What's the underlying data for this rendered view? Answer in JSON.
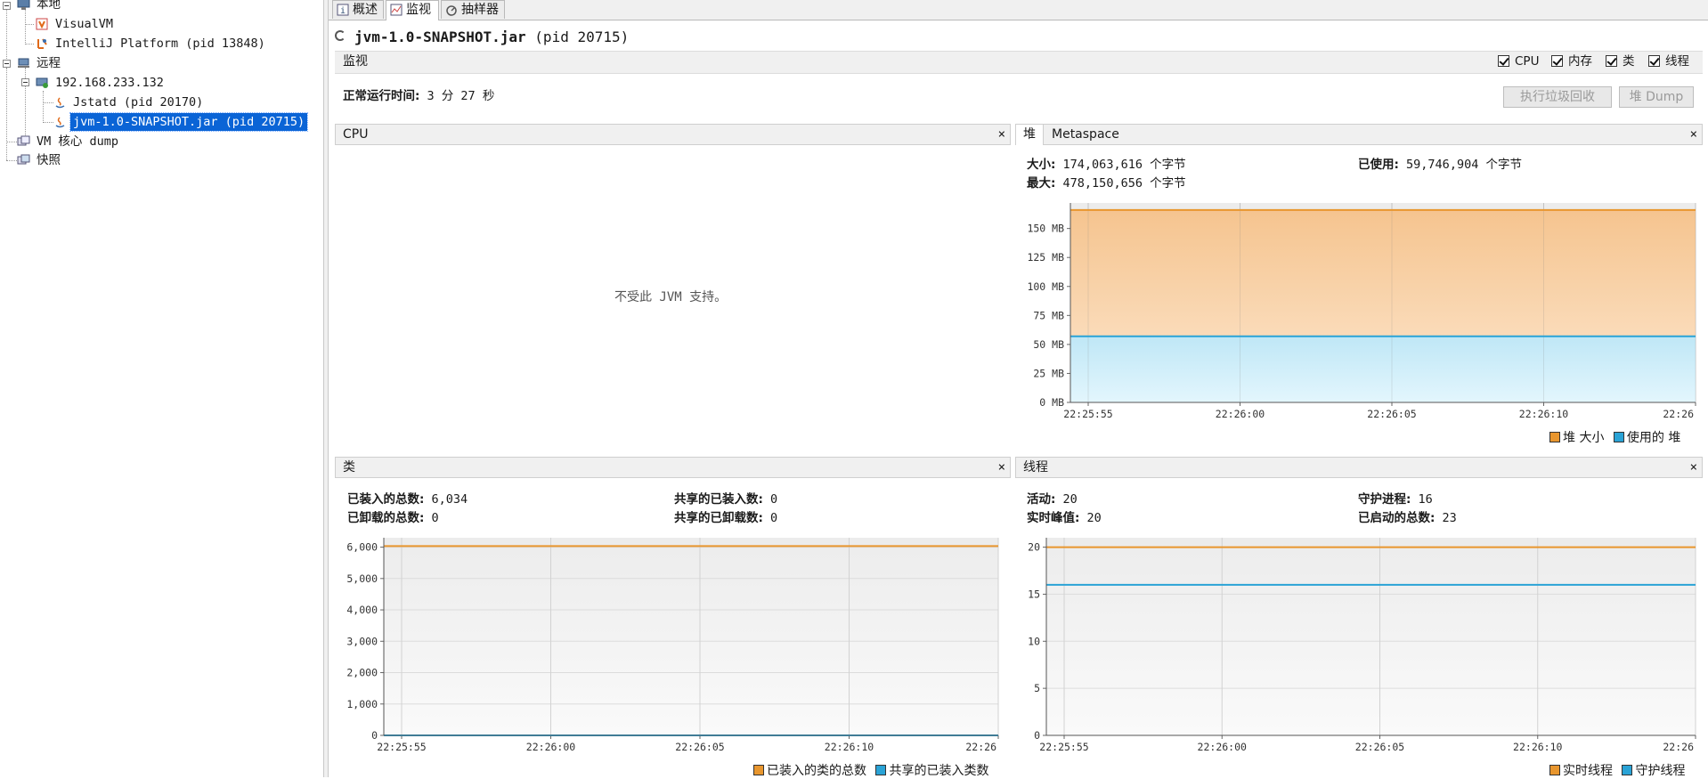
{
  "tree": {
    "local": "本地",
    "visualvm": "VisualVM",
    "intellij": "IntelliJ Platform (pid 13848)",
    "remote": "远程",
    "host": "192.168.233.132",
    "jstatd": "Jstatd (pid 20170)",
    "jvm": "jvm-1.0-SNAPSHOT.jar (pid 20715)",
    "coredump": "VM 核心 dump",
    "snapshots": "快照"
  },
  "tabs": [
    {
      "label": "概述"
    },
    {
      "label": "监视"
    },
    {
      "label": "抽样器"
    }
  ],
  "app": {
    "name": "jvm-1.0-SNAPSHOT.jar",
    "pid": "(pid 20715)"
  },
  "monitor": {
    "label": "监视",
    "checks": [
      "CPU",
      "内存",
      "类",
      "线程"
    ],
    "uptime_label": "正常运行时间:",
    "uptime_value": "3 分 27 秒",
    "gc_button": "执行垃圾回收",
    "dump_button": "堆 Dump"
  },
  "cpu_panel": {
    "title": "CPU",
    "close": "×",
    "message": "不受此 JVM 支持。"
  },
  "heap_panel": {
    "tab_heap": "堆",
    "tab_meta": "Metaspace",
    "close": "×",
    "size_label": "大小:",
    "size_value": "174,063,616 个字节",
    "max_label": "最大:",
    "max_value": "478,150,656 个字节",
    "used_label": "已使用:",
    "used_value": "59,746,904 个字节",
    "legend": [
      "堆 大小",
      "使用的 堆"
    ]
  },
  "classes_panel": {
    "title": "类",
    "close": "×",
    "loaded_label": "已装入的总数:",
    "loaded_value": "6,034",
    "unloaded_label": "已卸载的总数:",
    "unloaded_value": "0",
    "shared_loaded_label": "共享的已装入数:",
    "shared_loaded_value": "0",
    "shared_unloaded_label": "共享的已卸载数:",
    "shared_unloaded_value": "0",
    "legend": [
      "已装入的类的总数",
      "共享的已装入类数"
    ]
  },
  "threads_panel": {
    "title": "线程",
    "close": "×",
    "live_label": "活动:",
    "live_value": "20",
    "peak_label": "实时峰值:",
    "peak_value": "20",
    "daemon_label": "守护进程:",
    "daemon_value": "16",
    "started_label": "已启动的总数:",
    "started_value": "23",
    "legend": [
      "实时线程",
      "守护线程"
    ]
  },
  "colors": {
    "orange": "#e8962e",
    "blue": "#2aa3d6",
    "orange_fill_top": "#f5c48f",
    "orange_fill_bottom": "#fde7cf",
    "blue_fill_top": "#bfe7f6",
    "blue_fill_bottom": "#e3f6fd",
    "selection": "#0a64d6"
  },
  "chart_data": [
    {
      "type": "area",
      "title": "堆",
      "x": [
        "22:25:55",
        "22:26:00",
        "22:26:05",
        "22:26:10",
        "22:26"
      ],
      "y_ticks": [
        "0 MB",
        "25 MB",
        "50 MB",
        "75 MB",
        "100 MB",
        "125 MB",
        "150 MB"
      ],
      "ylim": [
        0,
        172
      ],
      "series": [
        {
          "name": "堆 大小",
          "values": [
            166,
            166,
            166,
            166,
            166
          ]
        },
        {
          "name": "使用的 堆",
          "values": [
            57,
            57,
            57,
            57,
            57
          ]
        }
      ]
    },
    {
      "type": "line",
      "title": "类",
      "x": [
        "22:25:55",
        "22:26:00",
        "22:26:05",
        "22:26:10",
        "22:26"
      ],
      "y_ticks": [
        "0",
        "1,000",
        "2,000",
        "3,000",
        "4,000",
        "5,000",
        "6,000"
      ],
      "ylim": [
        0,
        6300
      ],
      "series": [
        {
          "name": "已装入的类的总数",
          "values": [
            6034,
            6034,
            6034,
            6034,
            6034
          ]
        },
        {
          "name": "共享的已装入类数",
          "values": [
            0,
            0,
            0,
            0,
            0
          ]
        }
      ]
    },
    {
      "type": "line",
      "title": "线程",
      "x": [
        "22:25:55",
        "22:26:00",
        "22:26:05",
        "22:26:10",
        "22:26"
      ],
      "y_ticks": [
        "0",
        "5",
        "10",
        "15",
        "20"
      ],
      "ylim": [
        0,
        21
      ],
      "series": [
        {
          "name": "实时线程",
          "values": [
            20,
            20,
            20,
            20,
            20
          ]
        },
        {
          "name": "守护线程",
          "values": [
            16,
            16,
            16,
            16,
            16
          ]
        }
      ]
    }
  ]
}
